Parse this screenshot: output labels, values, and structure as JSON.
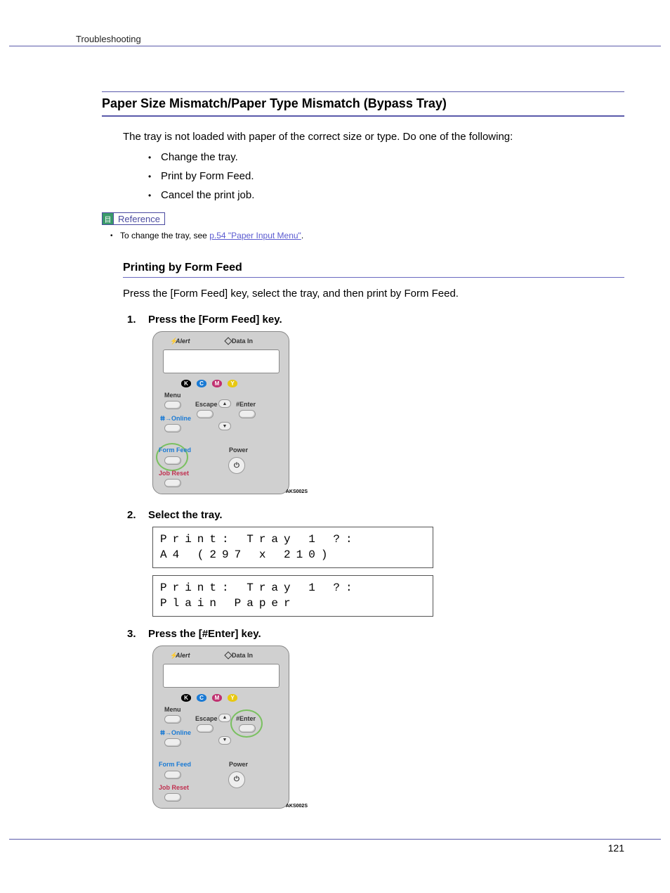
{
  "header": {
    "breadcrumb": "Troubleshooting"
  },
  "main": {
    "heading": "Paper Size Mismatch/Paper Type Mismatch (Bypass Tray)",
    "intro": "The tray is not loaded with paper of the correct size or type. Do one of the following:",
    "bullets": [
      "Change the tray.",
      "Print by Form Feed.",
      "Cancel the print job."
    ],
    "reference": {
      "badge_label": "Reference",
      "note_prefix": "To change the tray, see ",
      "link_text": "p.54 \"Paper Input Menu\"",
      "note_suffix": "."
    },
    "subheading": "Printing by Form Feed",
    "subdesc": "Press the [Form Feed] key, select the tray, and then print by Form Feed.",
    "steps": [
      {
        "title": "Press the [Form Feed] key."
      },
      {
        "title": "Select the tray."
      },
      {
        "title": "Press the [#Enter] key."
      }
    ],
    "lcd": {
      "box1_line1": "Print: Tray 1 ?:",
      "box1_line2": "A4 (297 x 210)",
      "box2_line1": "Print: Tray 1 ?:",
      "box2_line2": "Plain Paper"
    }
  },
  "panel": {
    "alert": "Alert",
    "data_in": "Data In",
    "menu": "Menu",
    "escape": "Escape",
    "enter": "#Enter",
    "online": "Online",
    "form_feed": "Form Feed",
    "job_reset": "Job Reset",
    "power": "Power",
    "toner_k": "K",
    "toner_c": "C",
    "toner_m": "M",
    "toner_y": "Y",
    "tag": "AKS002S"
  },
  "page_number": "121"
}
